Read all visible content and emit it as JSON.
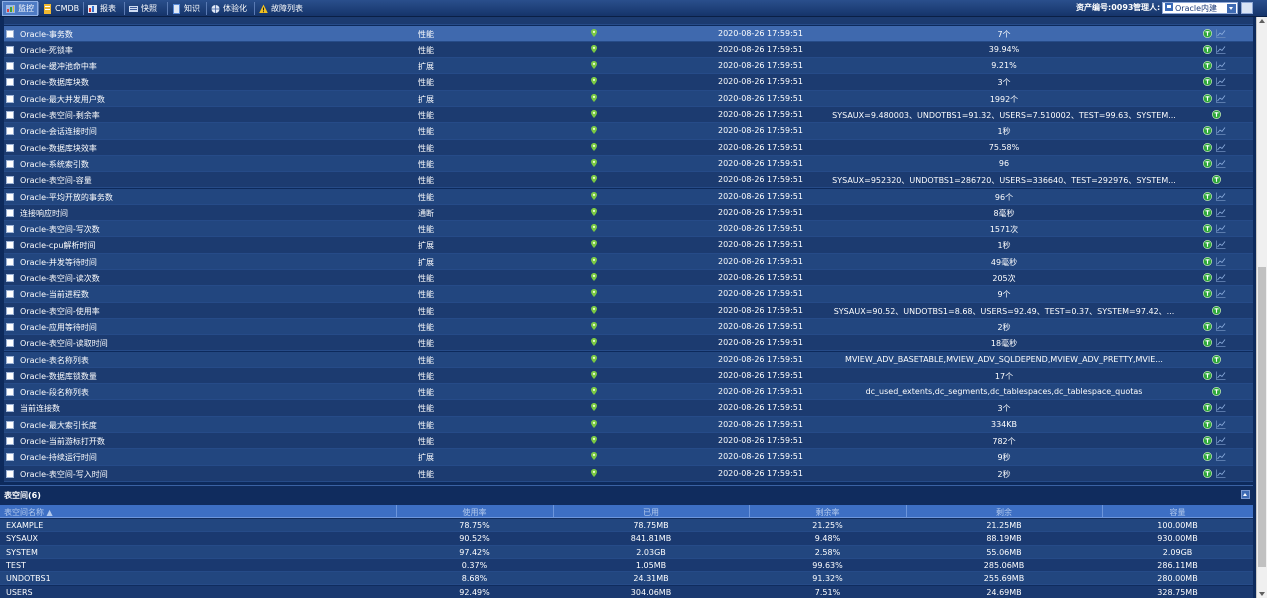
{
  "toolbar": {
    "buttons": [
      {
        "label": "监控",
        "icon": "monitor-icon",
        "active": true
      },
      {
        "label": "CMDB",
        "icon": "database-icon",
        "active": false
      },
      {
        "label": "报表",
        "icon": "report-icon",
        "active": false
      },
      {
        "label": "快照",
        "icon": "snapshot-icon",
        "active": false
      },
      {
        "label": "知识",
        "icon": "book-icon",
        "active": false
      },
      {
        "label": "体验化",
        "icon": "globe-icon",
        "active": false
      },
      {
        "label": "故障列表",
        "icon": "warning-icon",
        "active": false
      }
    ],
    "asset_label": "资产编号:0093",
    "manager_label": "管理人:",
    "select_value": "Oracle内建"
  },
  "monitor_rows": [
    {
      "name": "Oracle-事务数",
      "type": "性能",
      "time": "2020-08-26 17:59:51",
      "value": "7个",
      "chart": true,
      "selected": true
    },
    {
      "name": "Oracle-死锁率",
      "type": "性能",
      "time": "2020-08-26 17:59:51",
      "value": "39.94%",
      "chart": true
    },
    {
      "name": "Oracle-缓冲池命中率",
      "type": "扩展",
      "time": "2020-08-26 17:59:51",
      "value": "9.21%",
      "chart": true
    },
    {
      "name": "Oracle-数据库块数",
      "type": "性能",
      "time": "2020-08-26 17:59:51",
      "value": "3个",
      "chart": true
    },
    {
      "name": "Oracle-最大并发用户数",
      "type": "扩展",
      "time": "2020-08-26 17:59:51",
      "value": "1992个",
      "chart": true
    },
    {
      "name": "Oracle-表空间-剩余率",
      "type": "性能",
      "time": "2020-08-26 17:59:51",
      "value": "SYSAUX=9.480003、UNDOTBS1=91.32、USERS=7.510002、TEST=99.63、SYSTEM...",
      "chart": false
    },
    {
      "name": "Oracle-会话连接时间",
      "type": "性能",
      "time": "2020-08-26 17:59:51",
      "value": "1秒",
      "chart": true
    },
    {
      "name": "Oracle-数据库块效率",
      "type": "性能",
      "time": "2020-08-26 17:59:51",
      "value": "75.58%",
      "chart": true
    },
    {
      "name": "Oracle-系统索引数",
      "type": "性能",
      "time": "2020-08-26 17:59:51",
      "value": "96",
      "chart": true
    },
    {
      "name": "Oracle-表空间-容量",
      "type": "性能",
      "time": "2020-08-26 17:59:51",
      "value": "SYSAUX=952320、UNDOTBS1=286720、USERS=336640、TEST=292976、SYSTEM...",
      "chart": false
    },
    {
      "name": "Oracle-平均开放的事务数",
      "type": "性能",
      "time": "2020-08-26 17:59:51",
      "value": "96个",
      "chart": true
    },
    {
      "name": "连接响应时间",
      "type": "通断",
      "time": "2020-08-26 17:59:51",
      "value": "8毫秒",
      "chart": true
    },
    {
      "name": "Oracle-表空间-写次数",
      "type": "性能",
      "time": "2020-08-26 17:59:51",
      "value": "1571次",
      "chart": true
    },
    {
      "name": "Oracle-cpu解析时间",
      "type": "扩展",
      "time": "2020-08-26 17:59:51",
      "value": "1秒",
      "chart": true
    },
    {
      "name": "Oracle-并发等待时间",
      "type": "扩展",
      "time": "2020-08-26 17:59:51",
      "value": "49毫秒",
      "chart": true
    },
    {
      "name": "Oracle-表空间-读次数",
      "type": "性能",
      "time": "2020-08-26 17:59:51",
      "value": "205次",
      "chart": true
    },
    {
      "name": "Oracle-当前进程数",
      "type": "性能",
      "time": "2020-08-26 17:59:51",
      "value": "9个",
      "chart": true
    },
    {
      "name": "Oracle-表空间-使用率",
      "type": "性能",
      "time": "2020-08-26 17:59:51",
      "value": "SYSAUX=90.52、UNDOTBS1=8.68、USERS=92.49、TEST=0.37、SYSTEM=97.42、...",
      "chart": false
    },
    {
      "name": "Oracle-应用等待时间",
      "type": "性能",
      "time": "2020-08-26 17:59:51",
      "value": "2秒",
      "chart": true
    },
    {
      "name": "Oracle-表空间-读取时间",
      "type": "性能",
      "time": "2020-08-26 17:59:51",
      "value": "18毫秒",
      "chart": true
    },
    {
      "name": "Oracle-表名称列表",
      "type": "性能",
      "time": "2020-08-26 17:59:51",
      "value": "MVIEW_ADV_BASETABLE,MVIEW_ADV_SQLDEPEND,MVIEW_ADV_PRETTY,MVIE...",
      "chart": false
    },
    {
      "name": "Oracle-数据库锁数量",
      "type": "性能",
      "time": "2020-08-26 17:59:51",
      "value": "17个",
      "chart": true
    },
    {
      "name": "Oracle-段名称列表",
      "type": "性能",
      "time": "2020-08-26 17:59:51",
      "value": "dc_used_extents,dc_segments,dc_tablespaces,dc_tablespace_quotas",
      "chart": false
    },
    {
      "name": "当前连接数",
      "type": "性能",
      "time": "2020-08-26 17:59:51",
      "value": "3个",
      "chart": true
    },
    {
      "name": "Oracle-最大索引长度",
      "type": "性能",
      "time": "2020-08-26 17:59:51",
      "value": "334KB",
      "chart": true
    },
    {
      "name": "Oracle-当前游标打开数",
      "type": "性能",
      "time": "2020-08-26 17:59:51",
      "value": "782个",
      "chart": true
    },
    {
      "name": "Oracle-持续运行时间",
      "type": "扩展",
      "time": "2020-08-26 17:59:51",
      "value": "9秒",
      "chart": true
    },
    {
      "name": "Oracle-表空间-写入时间",
      "type": "性能",
      "time": "2020-08-26 17:59:51",
      "value": "2秒",
      "chart": true
    }
  ],
  "tablespace": {
    "title": "表空间(6)",
    "columns": [
      "表空间名称 ▲",
      "使用率",
      "已用",
      "剩余率",
      "剩余",
      "容量"
    ],
    "rows": [
      [
        "EXAMPLE",
        "78.75%",
        "78.75MB",
        "21.25%",
        "21.25MB",
        "100.00MB"
      ],
      [
        "SYSAUX",
        "90.52%",
        "841.81MB",
        "9.48%",
        "88.19MB",
        "930.00MB"
      ],
      [
        "SYSTEM",
        "97.42%",
        "2.03GB",
        "2.58%",
        "55.06MB",
        "2.09GB"
      ],
      [
        "TEST",
        "0.37%",
        "1.05MB",
        "99.63%",
        "285.06MB",
        "286.11MB"
      ],
      [
        "UNDOTBS1",
        "8.68%",
        "24.31MB",
        "91.32%",
        "255.69MB",
        "280.00MB"
      ],
      [
        "USERS",
        "92.49%",
        "304.06MB",
        "7.51%",
        "24.69MB",
        "328.75MB"
      ]
    ]
  },
  "colors": {
    "background": "#0d2a5c",
    "row_even": "#22467f",
    "row_odd": "#1c3b70",
    "row_selected": "#3f69ae",
    "header": "#3d6fc4",
    "status_ok": "#7ac943"
  }
}
